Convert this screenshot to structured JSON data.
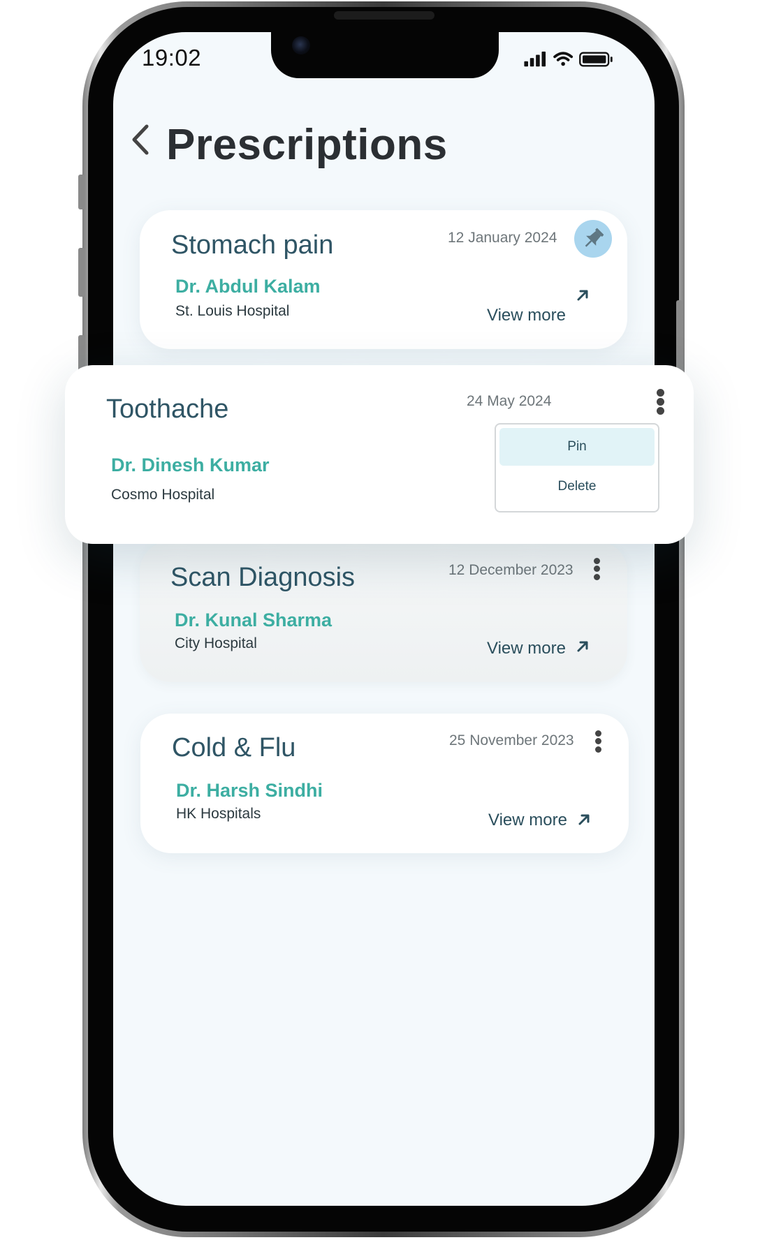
{
  "status_bar": {
    "time": "19:02"
  },
  "header": {
    "title": "Prescriptions"
  },
  "prescriptions": [
    {
      "condition": "Stomach pain",
      "date": "12 January 2024",
      "doctor": "Dr. Abdul Kalam",
      "hospital": "St. Louis Hospital",
      "view_more": "View more",
      "pinned": true
    },
    {
      "condition": "Toothache",
      "date": "24 May 2024",
      "doctor": "Dr. Dinesh Kumar",
      "hospital": "Cosmo Hospital",
      "menu_open": true
    },
    {
      "condition": "Scan Diagnosis",
      "date": "12 December 2023",
      "doctor": "Dr. Kunal Sharma",
      "hospital": "City Hospital",
      "view_more": "View more"
    },
    {
      "condition": "Cold & Flu",
      "date": "25 November 2023",
      "doctor": "Dr. Harsh Sindhi",
      "hospital": "HK Hospitals",
      "view_more": "View more"
    }
  ],
  "context_menu": {
    "pin_label": "Pin",
    "delete_label": "Delete"
  },
  "colors": {
    "accent": "#3daea2",
    "title": "#2f5565",
    "pin_bg": "#a9d5ee",
    "menu_highlight": "#e1f3f7",
    "screen_bg": "#f4f9fc"
  },
  "icons": {
    "back": "chevron-left-icon",
    "pin": "pushpin-icon",
    "more": "kebab-icon",
    "arrow": "arrow-up-right-icon",
    "signal": "signal-icon",
    "wifi": "wifi-icon",
    "battery": "battery-icon"
  }
}
